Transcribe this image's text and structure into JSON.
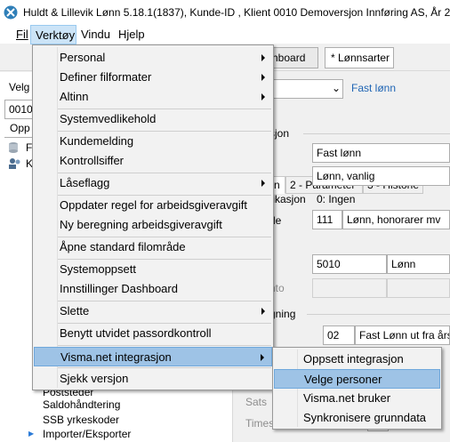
{
  "window": {
    "title": "Huldt & Lillevik Lønn 5.18.1(1837), Kunde-ID , Klient 0010 Demoversjon Innføring AS, År 2018"
  },
  "menubar": {
    "items": [
      "Fil",
      "Verktøy",
      "Vindu",
      "Hjelp"
    ]
  },
  "toolbar": {
    "tabs": [
      "hboard",
      "* Lønnsarter"
    ]
  },
  "left_panel": {
    "select_label": "Velg",
    "client_value": "0010",
    "tab_label": "Opp",
    "tree_stubs": [
      "F",
      "K"
    ],
    "tree_items": [
      "Poststeder",
      "Saldohåndtering",
      "SSB yrkeskoder",
      "Importer/Eksporter"
    ]
  },
  "right_panel": {
    "type_dropdown": "",
    "fast_lonn_link": "Fast lønn",
    "tabs": [
      "n",
      "2 - Parameter",
      "3 - Historie"
    ],
    "section_label": "sjon",
    "name_value": "Fast lønn",
    "category_value": "Lønn, vanlig",
    "classification_label": "fikasjon",
    "classification_value": "0: Ingen",
    "code_label": "de",
    "code_number": "111",
    "code_text": "Lønn, honorarer  mv",
    "account_number": "5010",
    "account_text": "Lønn",
    "account_label_grey": "nto",
    "calc_section_label": "gning",
    "calc_number": "02",
    "calc_text": "Fast Lønn ut fra års",
    "sats_label": "Sats",
    "timesats_label": "Times"
  },
  "verktoy_menu": {
    "items": [
      {
        "label": "Personal",
        "has_submenu": true
      },
      {
        "label": "Definer filformater",
        "has_submenu": true
      },
      {
        "label": "Altinn",
        "has_submenu": true
      },
      {
        "label": "Systemvedlikehold",
        "has_submenu": false
      },
      {
        "label": "Kundemelding",
        "has_submenu": false
      },
      {
        "label": "Kontrollsiffer",
        "has_submenu": false
      },
      {
        "label": "Låseflagg",
        "has_submenu": true
      },
      {
        "label": "Oppdater regel for arbeidsgiveravgift",
        "has_submenu": false
      },
      {
        "label": "Ny beregning arbeidsgiveravgift",
        "has_submenu": false
      },
      {
        "label": "Åpne standard filområde",
        "has_submenu": false
      },
      {
        "label": "Systemoppsett",
        "has_submenu": false
      },
      {
        "label": "Innstillinger Dashboard",
        "has_submenu": false
      },
      {
        "label": "Slette",
        "has_submenu": true
      },
      {
        "label": "Benytt utvidet passordkontroll",
        "has_submenu": false
      },
      {
        "label": "Visma.net integrasjon",
        "has_submenu": true,
        "highlighted": true
      },
      {
        "label": "Sjekk versjon",
        "has_submenu": false
      }
    ]
  },
  "visma_submenu": {
    "items": [
      {
        "label": "Oppsett integrasjon"
      },
      {
        "label": "Velge personer",
        "highlighted": true
      },
      {
        "label": "Visma.net bruker"
      },
      {
        "label": "Synkronisere grunndata"
      }
    ]
  },
  "colors": {
    "menu_highlight": "#9ec3e6",
    "menubar_active": "#cce4f7",
    "link_blue": "#1e64b4"
  }
}
